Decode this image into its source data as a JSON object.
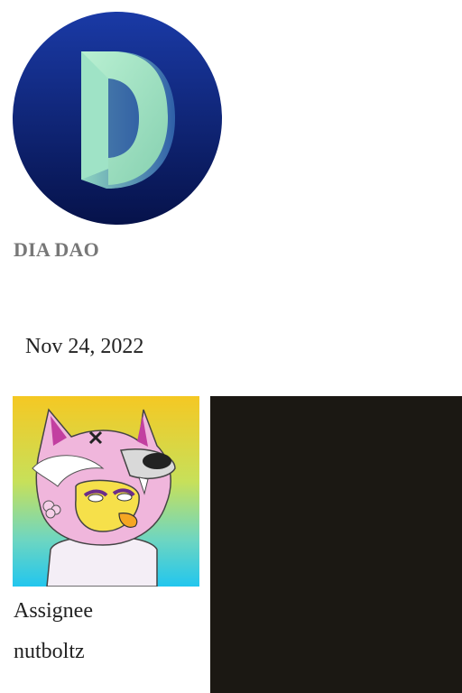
{
  "organization": {
    "name": "DIA DAO",
    "logo_icon": "dia-dao-logo-icon",
    "logo_colors": {
      "circle_top": "#1a3aa6",
      "circle_bottom": "#06124a",
      "letter_light": "#a8e6c4",
      "letter_dark": "#3f6fb0"
    }
  },
  "event": {
    "date": "Nov 24, 2022"
  },
  "assignee": {
    "label": "Assignee",
    "name": "nutboltz",
    "avatar_icon": "wolf-hood-avatar-icon"
  },
  "media": {
    "background_color": "#1b1813"
  }
}
